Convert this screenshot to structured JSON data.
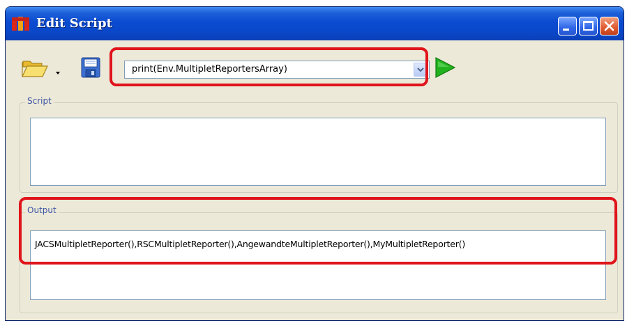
{
  "window": {
    "title": "Edit Script",
    "controls": {
      "minimize": "minimize",
      "maximize": "maximize",
      "close": "close"
    }
  },
  "toolbar": {
    "open_icon": "folder-open-icon",
    "save_icon": "floppy-save-icon",
    "run_icon": "play-run-icon",
    "script_combo": {
      "selected_value": "print(Env.MultipletReportersArray)"
    }
  },
  "script_panel": {
    "label": "Script",
    "content": ""
  },
  "output_panel": {
    "label": "Output",
    "content": "JACSMultipletReporter(),RSCMultipletReporter(),AngewandteMultipletReporter(),MyMultipletReporter()"
  },
  "colors": {
    "highlight": "#e0141b",
    "titlebar": "#0a4bd1",
    "window_bg": "#ece9d8",
    "run_green": "#22b21e"
  }
}
